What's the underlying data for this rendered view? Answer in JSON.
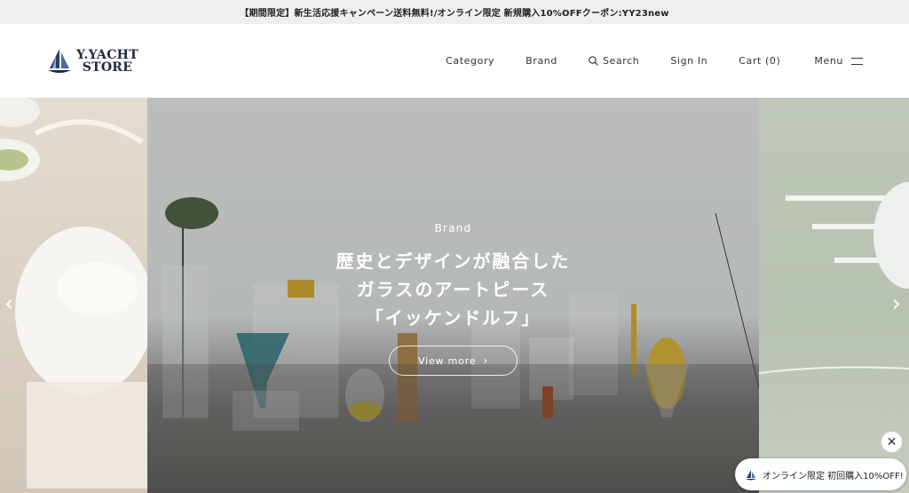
{
  "announcement": "【期間限定】新生活応援キャンペーン送料無料!/オンライン限定 新規購入10%OFFクーポン:YY23new",
  "logo": {
    "line1": "Y.YACHT",
    "line2": "STORE"
  },
  "nav": {
    "category": "Category",
    "brand": "Brand",
    "search": "Search",
    "signin": "Sign In",
    "cart": "Cart (0)",
    "menu": "Menu"
  },
  "hero": {
    "eyebrow": "Brand",
    "title_line1": "歴史とデザインが融合した",
    "title_line2": "ガラスのアートピース",
    "title_line3": "「イッケンドルフ」",
    "cta": "View more"
  },
  "popup": {
    "close": "✕",
    "coupon": "オンライン限定 初回購入10%OFF!"
  },
  "colors": {
    "brand_navy": "#1d2a44"
  }
}
